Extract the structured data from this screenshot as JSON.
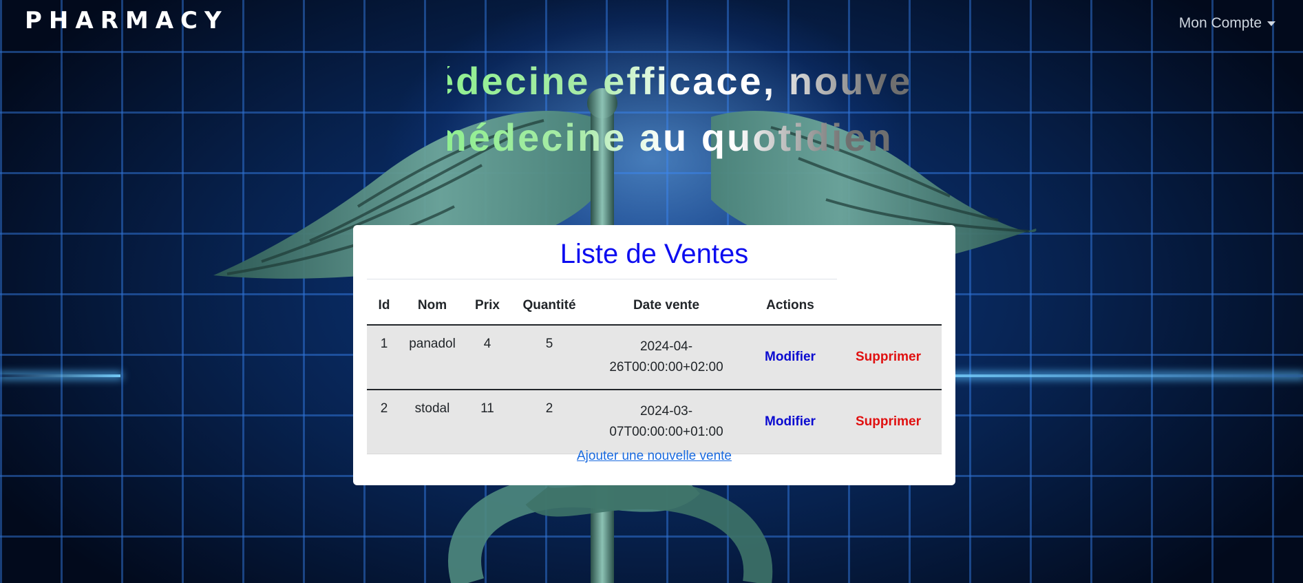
{
  "navbar": {
    "brand": "PHARMACY",
    "account_label": "Mon Compte"
  },
  "banner": {
    "line1": "édecine efficace, nouvelle",
    "line2": "médecine au quotidien !"
  },
  "sales": {
    "title": "Liste de Ventes",
    "columns": [
      "Id",
      "Nom",
      "Prix",
      "Quantité",
      "Date vente",
      "Actions"
    ],
    "rows": [
      {
        "id": "1",
        "nom": "panadol",
        "prix": "4",
        "quantite": "5",
        "date_line1": "2024-04-",
        "date_line2": "26T00:00:00+02:00",
        "modify": "Modifier",
        "delete": "Supprimer"
      },
      {
        "id": "2",
        "nom": "stodal",
        "prix": "11",
        "quantite": "2",
        "date_line1": "2024-03-",
        "date_line2": "07T00:00:00+01:00",
        "modify": "Modifier",
        "delete": "Supprimer"
      }
    ],
    "add_link": "Ajouter une nouvelle vente"
  },
  "colors": {
    "title": "#0d0df0",
    "modify": "#0b0bd0",
    "delete": "#e01010",
    "link": "#1a6be0"
  },
  "icons": {
    "account_caret": "caret-down-icon",
    "background": "caduceus-emblem"
  }
}
